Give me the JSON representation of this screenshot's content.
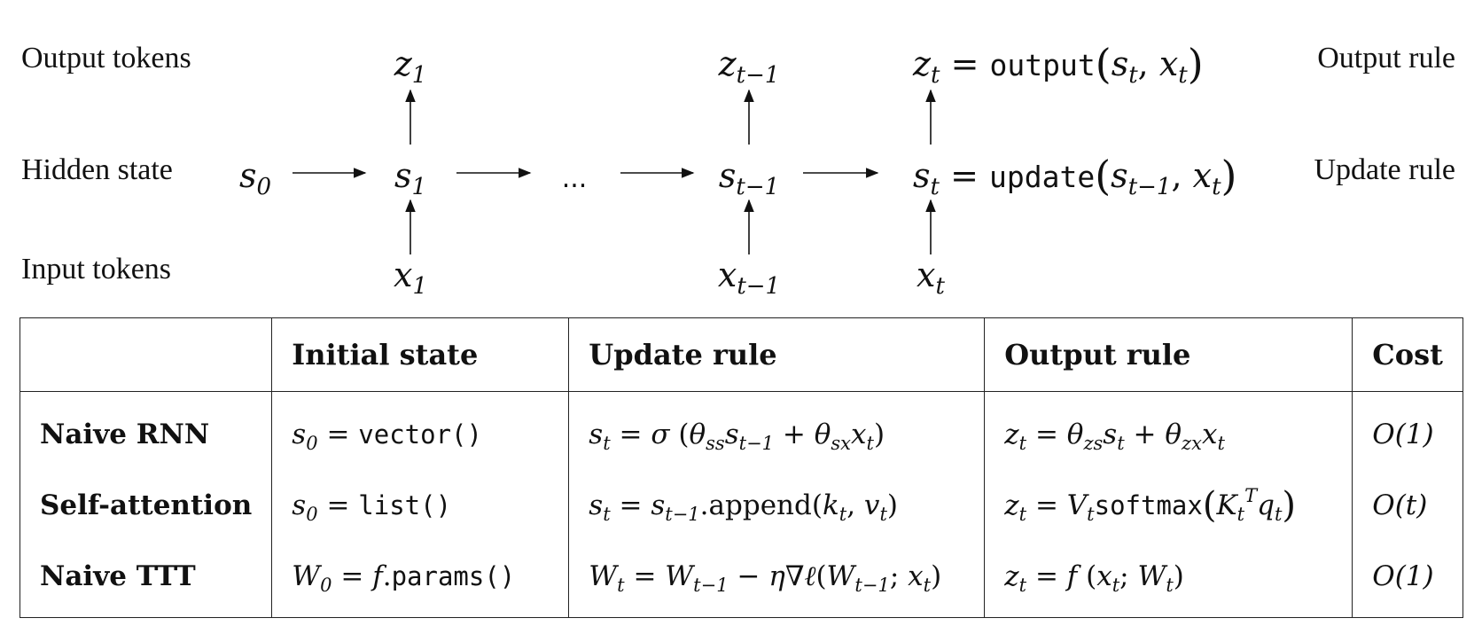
{
  "diagram": {
    "labels": {
      "output_tokens": "Output tokens",
      "hidden_state": "Hidden state",
      "input_tokens": "Input tokens",
      "output_rule": "Output rule",
      "update_rule": "Update rule"
    },
    "ellipsis": "...",
    "output_fn": "output",
    "update_fn": "update"
  },
  "table": {
    "headers": [
      "",
      "Initial state",
      "Update rule",
      "Output rule",
      "Cost"
    ],
    "rows": [
      {
        "name": "Naive RNN",
        "init_fn": "vector()",
        "cost": "O(1)"
      },
      {
        "name": "Self-attention",
        "init_fn": "list()",
        "append": ".append",
        "softmax": "softmax",
        "cost": "O(t)"
      },
      {
        "name": "Naive TTT",
        "init_fn": "params()",
        "cost": "O(1)"
      }
    ]
  }
}
